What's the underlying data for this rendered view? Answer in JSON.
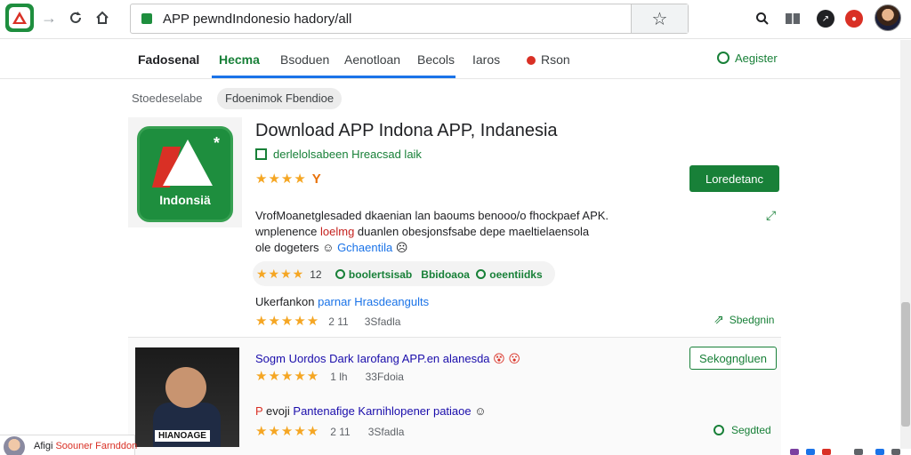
{
  "browser": {
    "url": "APP  pewndIndonesio hadory/all"
  },
  "site_nav": {
    "brand": "Fadosenal",
    "tabs": [
      "Hecma",
      "Bsoduen",
      "Aenotloan",
      "Becols",
      "Iaros",
      "Rson"
    ],
    "active_tab": 0,
    "register_label": "Aegister"
  },
  "breadcrumb": {
    "text": "Stoedeselabe",
    "chip": "Fdoenimok  Fbendioe"
  },
  "app_card": {
    "title": "Download APP Indona APP, Indanesia",
    "verified": "derlelolsabeen Hreacsad laik",
    "rating_stars": "★★★★",
    "rating_extra": "Y",
    "icon_label": "Indonsiä",
    "download_button": "Loredetanc",
    "description": {
      "line1": "VrofMoanetglesaded dkaenian lan baoums benooo/o fhockpaef APK.",
      "line2_part1": "wnplenence ",
      "line2_red": "loelmg",
      "line2_part2": " duanlen obesjonsfsabe depe maeltielaensola",
      "line3_part1": "ole dogeters ",
      "line3_emoji": "☺",
      "line3_blue": " Gchaentila",
      "line3_emoji2": "☹"
    },
    "stats": {
      "stars": "★★★★",
      "count": "12",
      "item1": "boolertsisab",
      "item2": "Bbidoaoa",
      "item3": "oeentiidks"
    },
    "sub": {
      "label": "Ukerfankon ",
      "link": "parnar Hrasdeangults"
    },
    "meta": {
      "stars": "★★★★★",
      "count": "2 11",
      "extra": "3Sfadla"
    },
    "side_link": "Sbedgnin"
  },
  "second_card": {
    "title": "Sogm Uordos Dark Iarofang APP.en alanesda",
    "title_emoji": "😵 😮",
    "meta": {
      "stars": "★★★★★",
      "count": "1 lh",
      "extra": "33Fdoia"
    },
    "button": "Sekogngluen",
    "thumb_caption": "HIANOAGE",
    "sub": {
      "mark": "P",
      "text1": " evoji ",
      "link": "Pantenafige Karnihlopener patiaoe",
      "icon": "☺"
    },
    "meta2": {
      "stars": "★★★★★",
      "count": "2 11",
      "extra": "3Sfadla"
    },
    "side_link": "Segdted"
  },
  "notification": {
    "prefix": "Afigi ",
    "red": "Soouner Farnddon"
  },
  "colors": {
    "accent_green": "#188038",
    "link_blue": "#1a73e8",
    "star_gold": "#f5a623",
    "alert_red": "#d93025"
  },
  "icons": {
    "back": "arrow-left-icon",
    "forward": "arrow-right-icon",
    "reload": "reload-icon",
    "home": "home-icon",
    "bookmark": "star-icon",
    "search": "search-icon",
    "reader": "reader-icon",
    "extension": "extension-icon",
    "notifications": "notification-icon"
  }
}
